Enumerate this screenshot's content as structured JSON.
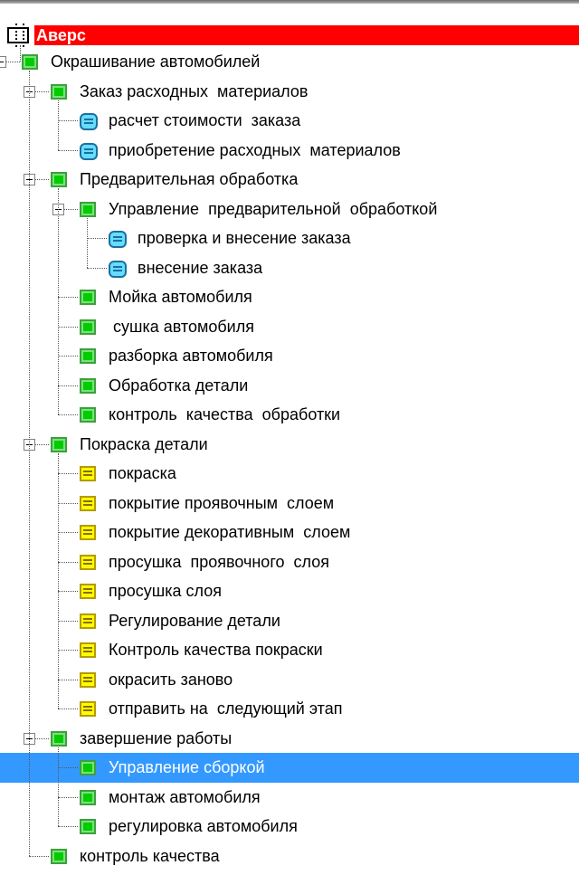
{
  "tree": {
    "root": "Аверс",
    "items": [
      {
        "label": "Окрашивание автомобилей",
        "icon": "folder-icon"
      },
      {
        "label": "Заказ расходных  материалов",
        "icon": "folder-icon"
      },
      {
        "label": "расчет стоимости  заказа",
        "icon": "process-icon"
      },
      {
        "label": "приобретение расходных  материалов",
        "icon": "process-icon"
      },
      {
        "label": "Предварительная обработка",
        "icon": "folder-icon"
      },
      {
        "label": "Управление  предварительной  обработкой",
        "icon": "folder-icon"
      },
      {
        "label": "проверка и внесение заказа",
        "icon": "process-icon"
      },
      {
        "label": "внесение заказа",
        "icon": "process-icon"
      },
      {
        "label": "Мойка автомобиля",
        "icon": "folder-icon"
      },
      {
        "label": " сушка автомобиля",
        "icon": "folder-icon"
      },
      {
        "label": "разборка автомобиля",
        "icon": "folder-icon"
      },
      {
        "label": "Обработка детали",
        "icon": "folder-icon"
      },
      {
        "label": "контроль  качества  обработки",
        "icon": "folder-icon"
      },
      {
        "label": "Покраска детали",
        "icon": "folder-icon"
      },
      {
        "label": "покраска",
        "icon": "task-icon"
      },
      {
        "label": "покрытие проявочным  слоем",
        "icon": "task-icon"
      },
      {
        "label": "покрытие декоративным  слоем",
        "icon": "task-icon"
      },
      {
        "label": "просушка  проявочного  слоя",
        "icon": "task-icon"
      },
      {
        "label": "просушка слоя",
        "icon": "task-icon"
      },
      {
        "label": "Регулирование детали",
        "icon": "task-icon"
      },
      {
        "label": "Контроль качества покраски",
        "icon": "task-icon"
      },
      {
        "label": "окрасить заново",
        "icon": "task-icon"
      },
      {
        "label": "отправить на  следующий этап",
        "icon": "task-icon"
      },
      {
        "label": "завершение работы",
        "icon": "folder-icon"
      },
      {
        "label": "Управление сборкой",
        "icon": "folder-icon",
        "selected": true
      },
      {
        "label": "монтаж автомобиля",
        "icon": "folder-icon"
      },
      {
        "label": "регулировка автомобиля",
        "icon": "folder-icon"
      },
      {
        "label": "контроль качества",
        "icon": "folder-icon"
      }
    ]
  }
}
